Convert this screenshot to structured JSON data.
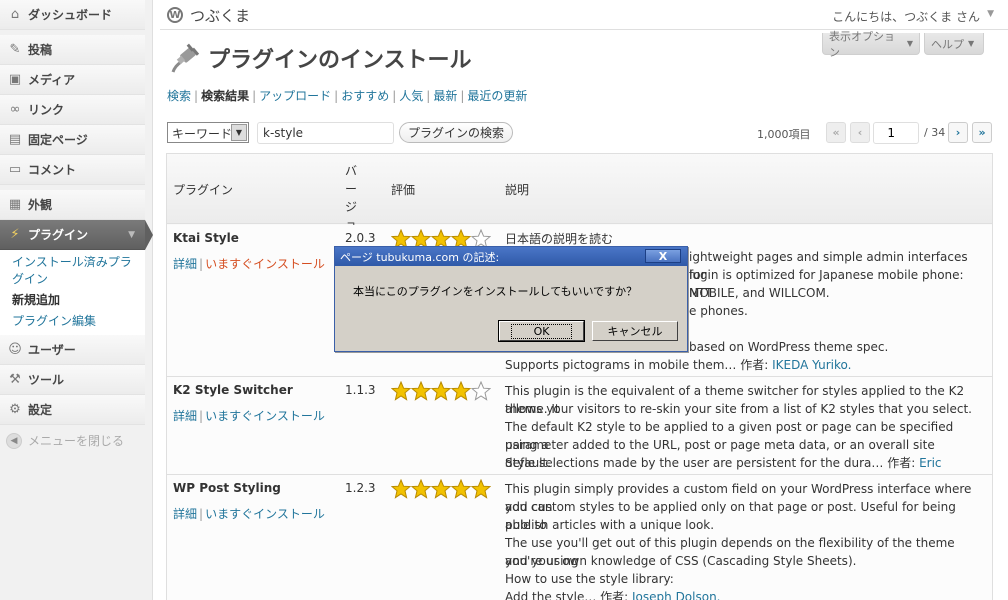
{
  "sidebar": {
    "items": [
      {
        "key": "dashboard",
        "label": "ダッシュボード",
        "icon": "dashboard-icon"
      },
      {
        "key": "posts",
        "label": "投稿",
        "icon": "pin-icon"
      },
      {
        "key": "media",
        "label": "メディア",
        "icon": "media-icon"
      },
      {
        "key": "links",
        "label": "リンク",
        "icon": "link-icon"
      },
      {
        "key": "pages",
        "label": "固定ページ",
        "icon": "page-icon"
      },
      {
        "key": "comments",
        "label": "コメント",
        "icon": "comment-icon"
      },
      {
        "key": "appearance",
        "label": "外観",
        "icon": "appearance-icon"
      },
      {
        "key": "plugins",
        "label": "プラグイン",
        "icon": "plugin-icon"
      },
      {
        "key": "users",
        "label": "ユーザー",
        "icon": "users-icon"
      },
      {
        "key": "tools",
        "label": "ツール",
        "icon": "tools-icon"
      },
      {
        "key": "settings",
        "label": "設定",
        "icon": "settings-icon"
      }
    ],
    "submenu": [
      {
        "label": "インストール済みプラグイン"
      },
      {
        "label": "新規追加"
      },
      {
        "label": "プラグイン編集"
      }
    ],
    "collapse_label": "メニューを閉じる"
  },
  "header": {
    "site_name": "つぶくま",
    "greeting": "こんにちは、つぶくま さん",
    "screen_options": "表示オプション",
    "help": "ヘルプ"
  },
  "page": {
    "title": "プラグインのインストール",
    "subnav": [
      "検索",
      "検索結果",
      "アップロード",
      "おすすめ",
      "人気",
      "最新",
      "最近の更新"
    ]
  },
  "search": {
    "type_value": "キーワード",
    "query": "k-style",
    "button": "プラグインの検索",
    "item_count": "1,000項目",
    "page_current": "1",
    "page_total": "/ 34",
    "first": "«",
    "prev": "‹",
    "next": "›",
    "last": "»"
  },
  "table": {
    "headers": {
      "plugin": "プラグイン",
      "version": "バージョン",
      "rating": "評価",
      "description": "説明"
    },
    "links": {
      "details": "詳細",
      "install": "いますぐインストール"
    },
    "rows": [
      {
        "name": "Ktai Style",
        "version": "2.0.3",
        "rating": 4,
        "desc": [
          "日本語の説明を読む",
          "ightweight pages and simple admin interfaces for",
          "lugin is optimized for Japanese mobile phone: NTT",
          "MOBILE, and WILLCOM.",
          "e phones.",
          "",
          "based on WordPress theme spec."
        ],
        "desc_last": "Supports pictograms in mobile them… 作者: ",
        "author": "IKEDA Yuriko."
      },
      {
        "name": "K2 Style Switcher",
        "version": "1.1.3",
        "rating": 4,
        "desc": [
          "This plugin is the equivalent of a theme switcher for styles applied to the K2 theme. It",
          "allows your visitors to re-skin your site from a list of K2 styles that you select.",
          "The default K2 style to be applied to a given post or page can be specified using a",
          "parameter added to the URL, post or page meta data, or an overall site default."
        ],
        "desc_last": "Style selections made by the user are persistent for the dura… 作者: ",
        "author": "Eric Marden."
      },
      {
        "name": "WP Post Styling",
        "version": "1.2.3",
        "rating": 5,
        "desc": [
          "This plugin simply provides a custom field on your WordPress interface where you can",
          "add custom styles to be applied only on that page or post. Useful for being able to",
          "publish articles with a unique look.",
          "The use you'll get out of this plugin depends on the flexibility of the theme you're using",
          "and your own knowledge of CSS (Cascading Style Sheets).",
          "How to use the style library:"
        ],
        "desc_last": "Add the style… 作者: ",
        "author": "Joseph Dolson."
      }
    ]
  },
  "dialog": {
    "title": "ページ tubukuma.com の記述:",
    "message": "本当にこのプラグインをインストールしてもいいですか？",
    "ok": "OK",
    "cancel": "キャンセル",
    "close": "X"
  },
  "colors": {
    "link": "#21759b",
    "install_hot": "#d54e21",
    "star": "#f2c200"
  }
}
